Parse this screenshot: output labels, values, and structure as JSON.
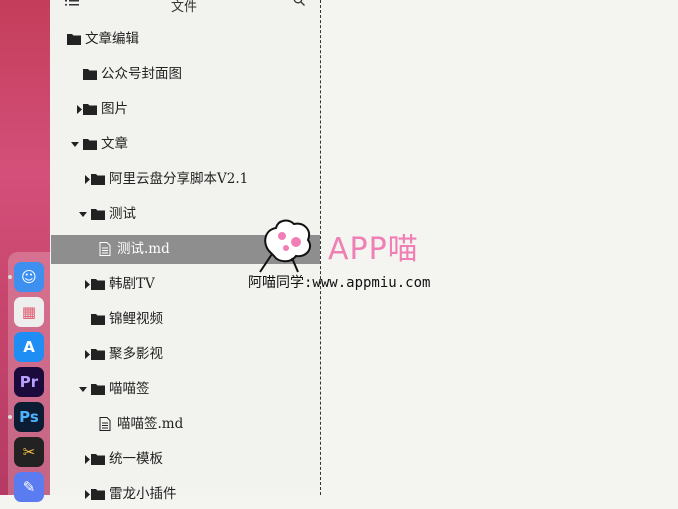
{
  "sidebar": {
    "header_title": "文件",
    "items": [
      {
        "label": "文章编辑",
        "icon": "folder-icon",
        "arrow": null,
        "selected": false
      },
      {
        "label": "公众号封面图",
        "icon": "folder-icon",
        "arrow": null,
        "selected": false
      },
      {
        "label": "图片",
        "icon": "folder-icon",
        "arrow": "right",
        "selected": false
      },
      {
        "label": "文章",
        "icon": "folder-icon",
        "arrow": "down",
        "selected": false
      },
      {
        "label": "阿里云盘分享脚本V2.1",
        "icon": "folder-icon",
        "arrow": "right",
        "selected": false
      },
      {
        "label": "测试",
        "icon": "folder-icon",
        "arrow": "down",
        "selected": false
      },
      {
        "label": "测试.md",
        "icon": "document-icon",
        "arrow": null,
        "selected": true
      },
      {
        "label": "韩剧TV",
        "icon": "folder-icon",
        "arrow": "right",
        "selected": false
      },
      {
        "label": "锦鲤视频",
        "icon": "folder-icon",
        "arrow": null,
        "selected": false
      },
      {
        "label": "聚多影视",
        "icon": "folder-icon",
        "arrow": "right",
        "selected": false
      },
      {
        "label": "喵喵签",
        "icon": "folder-icon",
        "arrow": "down",
        "selected": false
      },
      {
        "label": "喵喵签.md",
        "icon": "document-icon",
        "arrow": null,
        "selected": false
      },
      {
        "label": "统一模板",
        "icon": "folder-icon",
        "arrow": "right",
        "selected": false
      },
      {
        "label": "雷龙小插件",
        "icon": "folder-icon",
        "arrow": "right",
        "selected": false
      }
    ]
  },
  "dock": {
    "apps": [
      {
        "name": "finder-icon",
        "glyph": "☺",
        "bg": "#3d8ff0",
        "fg": "#ffffff"
      },
      {
        "name": "launchpad-icon",
        "glyph": "▦",
        "bg": "#eeeeee",
        "fg": "#e0566a"
      },
      {
        "name": "app-store-icon",
        "glyph": "A",
        "bg": "#1e8ef5",
        "fg": "#ffffff"
      },
      {
        "name": "premiere-pro-icon",
        "glyph": "Pr",
        "bg": "#1b0a3c",
        "fg": "#b9a2ff"
      },
      {
        "name": "photoshop-icon",
        "glyph": "Ps",
        "bg": "#0b1c33",
        "fg": "#4fb2ff"
      },
      {
        "name": "final-cut-pro-icon",
        "glyph": "✂",
        "bg": "#222222",
        "fg": "#f6c246"
      },
      {
        "name": "pencil-app-icon",
        "glyph": "✎",
        "bg": "#5b7cf0",
        "fg": "#ffffff"
      }
    ]
  },
  "watermark": {
    "brand": "APP喵",
    "caption": "阿喵同学:www.appmiu.com"
  },
  "colors": {
    "selected_bg": "#8e8e8e",
    "watermark_pink": "#f07fb5"
  }
}
